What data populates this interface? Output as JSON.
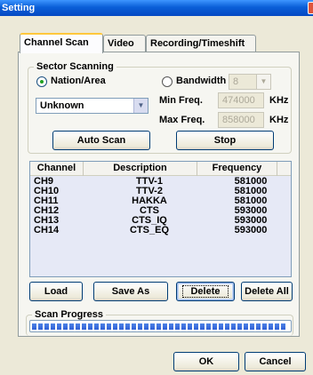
{
  "window": {
    "title": "Setting"
  },
  "tabs": [
    {
      "label": "Channel Scan",
      "active": true
    },
    {
      "label": "Video",
      "active": false
    },
    {
      "label": "Recording/Timeshift",
      "active": false
    }
  ],
  "sector": {
    "group_title": "Sector Scanning",
    "nation_label": "Nation/Area",
    "nation_selected": true,
    "bandwidth_label": "Bandwidth",
    "bandwidth_selected": false,
    "nation_value": "Unknown",
    "bandwidth_value": "8",
    "min_freq_label": "Min Freq.",
    "min_freq_value": "474000",
    "max_freq_label": "Max Freq.",
    "max_freq_value": "858000",
    "unit_label": "KHz"
  },
  "buttons": {
    "auto_scan": "Auto Scan",
    "stop": "Stop",
    "load": "Load",
    "save_as": "Save As",
    "delete": "Delete",
    "delete_all": "Delete All",
    "ok": "OK",
    "cancel": "Cancel"
  },
  "channel_list": {
    "columns": [
      "Channel",
      "Description",
      "Frequency"
    ],
    "rows": [
      {
        "channel": "CH9",
        "description": "TTV-1",
        "frequency": "581000"
      },
      {
        "channel": "CH10",
        "description": "TTV-2",
        "frequency": "581000"
      },
      {
        "channel": "CH11",
        "description": "HAKKA",
        "frequency": "581000"
      },
      {
        "channel": "CH12",
        "description": "CTS",
        "frequency": "593000"
      },
      {
        "channel": "CH13",
        "description": "CTS_IQ",
        "frequency": "593000"
      },
      {
        "channel": "CH14",
        "description": "CTS_EQ",
        "frequency": "593000"
      }
    ]
  },
  "scan_progress": {
    "label": "Scan Progress",
    "fraction": 1.0
  },
  "colors": {
    "title_bar": "#0a5fd8",
    "list_bg": "#e6e9f6",
    "progress_fill": "#2a5bd4",
    "tab_highlight": "#ffc83c"
  },
  "icons": {
    "close": "close-icon",
    "combo_arrow": "chevron-down-icon"
  }
}
